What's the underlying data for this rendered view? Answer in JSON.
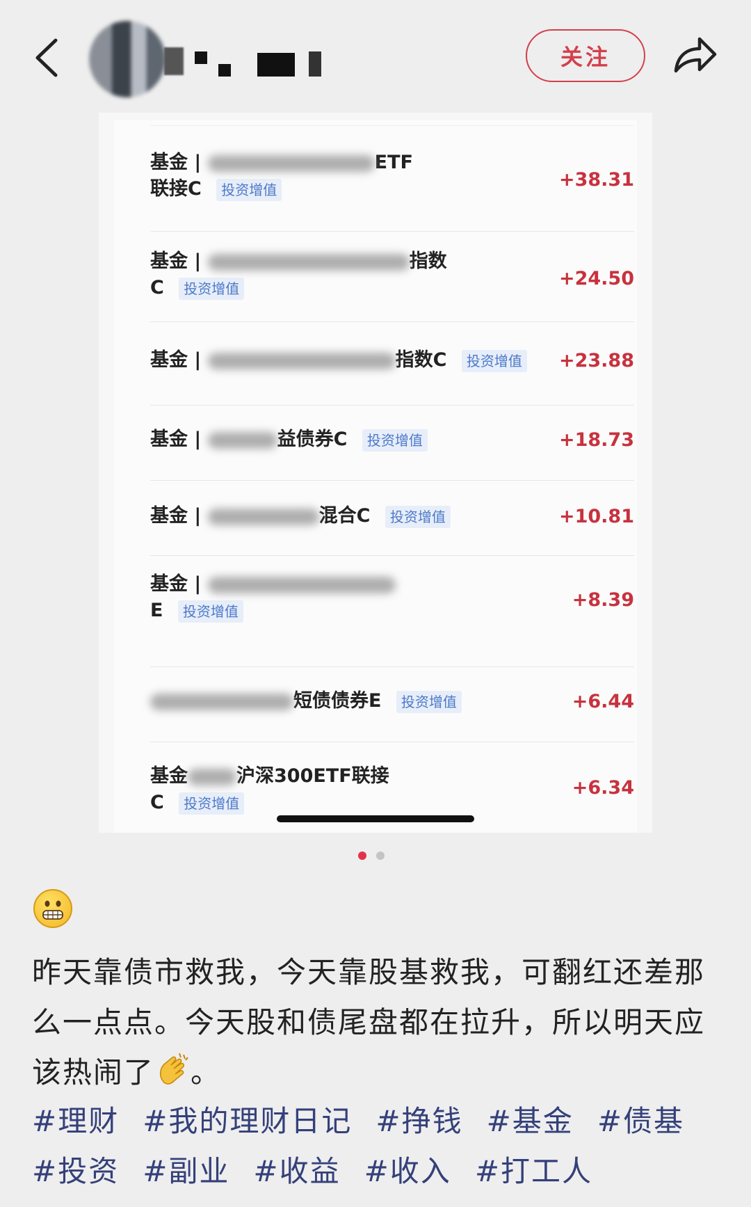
{
  "header": {
    "follow_label": "关注"
  },
  "fund_rows": [
    {
      "line1_prefix": "基金 |",
      "line1_suffix": "ETF",
      "line2": "联接C",
      "tag": "投资增值",
      "amount": "+38.31"
    },
    {
      "line1_prefix": "基金 |",
      "line1_suffix": "指数",
      "line2": "C",
      "tag": "投资增值",
      "amount": "+24.50"
    },
    {
      "line1_prefix": "基金 |",
      "line1_suffix": "指数C",
      "line2": "",
      "tag": "投资增值",
      "amount": "+23.88"
    },
    {
      "line1_prefix": "基金 |",
      "line1_suffix": "益债券C",
      "line2": "",
      "tag": "投资增值",
      "amount": "+18.73"
    },
    {
      "line1_prefix": "基金 |",
      "line1_suffix": "混合C",
      "line2": "",
      "tag": "投资增值",
      "amount": "+10.81"
    },
    {
      "line1_prefix": "基金 |",
      "line1_suffix": "",
      "line2": "E",
      "tag": "投资增值",
      "amount": "+8.39"
    },
    {
      "line1_prefix": "",
      "line1_suffix": "短债债券E",
      "line2": "",
      "tag": "投资增值",
      "amount": "+6.44"
    },
    {
      "line1_prefix": "基金",
      "line1_suffix": "沪深300ETF联接",
      "line2": "C",
      "tag": "投资增值",
      "amount": "+6.34"
    }
  ],
  "carousel": {
    "current": 1,
    "total": 2
  },
  "post": {
    "emoji": "grimacing-face",
    "text_before_emoji": "昨天靠债市救我，今天靠股基救我，可翻红还差那么一点点。今天股和债尾盘都在拉升，所以明天应该热闹了",
    "text_after_emoji": "。",
    "inline_emoji": "clapping-hands",
    "hashtags": [
      "#理财",
      "#我的理财日记",
      "#挣钱",
      "#基金",
      "#债基",
      "#投资",
      "#副业",
      "#收益",
      "#收入",
      "#打工人"
    ]
  },
  "colors": {
    "accent_red": "#d3404c",
    "amount_red": "#c7323e",
    "tag_blue": "#4d79c9",
    "hashtag": "#34407a",
    "background": "#eeeeee"
  }
}
